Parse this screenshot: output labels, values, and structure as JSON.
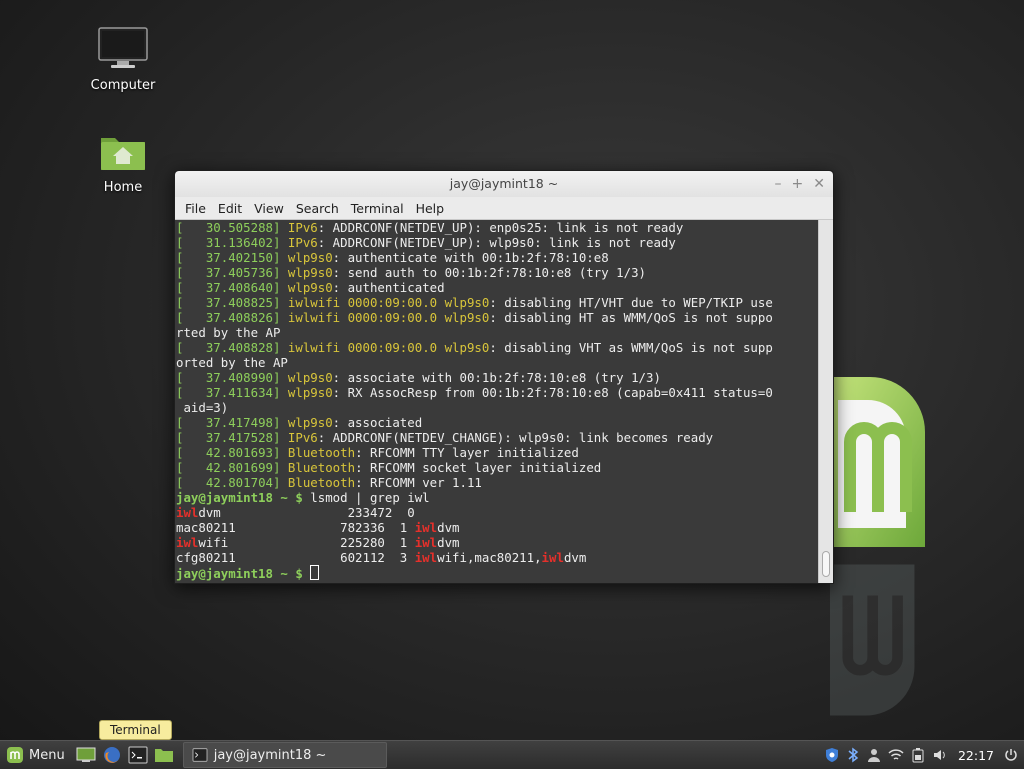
{
  "desktop": {
    "icons": [
      {
        "label": "Computer"
      },
      {
        "label": "Home"
      }
    ]
  },
  "window": {
    "title": "jay@jaymint18 ~",
    "menu": [
      "File",
      "Edit",
      "View",
      "Search",
      "Terminal",
      "Help"
    ]
  },
  "terminal": {
    "lines": [
      [
        {
          "t": "[",
          "c": "ts"
        },
        {
          "t": "   30.505288]",
          "c": "ts"
        },
        {
          "t": " IPv6",
          "c": "yel"
        },
        {
          "t": ": ADDRCONF(NETDEV_UP): enp0s25: link is not ready"
        }
      ],
      [
        {
          "t": "[",
          "c": "ts"
        },
        {
          "t": "   31.136402]",
          "c": "ts"
        },
        {
          "t": " IPv6",
          "c": "yel"
        },
        {
          "t": ": ADDRCONF(NETDEV_UP): wlp9s0: link is not ready"
        }
      ],
      [
        {
          "t": "[",
          "c": "ts"
        },
        {
          "t": "   37.402150]",
          "c": "ts"
        },
        {
          "t": " wlp9s0",
          "c": "yel"
        },
        {
          "t": ": authenticate with 00:1b:2f:78:10:e8"
        }
      ],
      [
        {
          "t": "[",
          "c": "ts"
        },
        {
          "t": "   37.405736]",
          "c": "ts"
        },
        {
          "t": " wlp9s0",
          "c": "yel"
        },
        {
          "t": ": send auth to 00:1b:2f:78:10:e8 (try 1/3)"
        }
      ],
      [
        {
          "t": "[",
          "c": "ts"
        },
        {
          "t": "   37.408640]",
          "c": "ts"
        },
        {
          "t": " wlp9s0",
          "c": "yel"
        },
        {
          "t": ": authenticated"
        }
      ],
      [
        {
          "t": "[",
          "c": "ts"
        },
        {
          "t": "   37.408825]",
          "c": "ts"
        },
        {
          "t": " iwlwifi 0000:09:00.0 wlp9s0",
          "c": "yel"
        },
        {
          "t": ": disabling HT/VHT due to WEP/TKIP use"
        }
      ],
      [
        {
          "t": "[",
          "c": "ts"
        },
        {
          "t": "   37.408826]",
          "c": "ts"
        },
        {
          "t": " iwlwifi 0000:09:00.0 wlp9s0",
          "c": "yel"
        },
        {
          "t": ": disabling HT as WMM/QoS is not suppo"
        }
      ],
      [
        {
          "t": "rted by the AP"
        }
      ],
      [
        {
          "t": "[",
          "c": "ts"
        },
        {
          "t": "   37.408828]",
          "c": "ts"
        },
        {
          "t": " iwlwifi 0000:09:00.0 wlp9s0",
          "c": "yel"
        },
        {
          "t": ": disabling VHT as WMM/QoS is not supp"
        }
      ],
      [
        {
          "t": "orted by the AP"
        }
      ],
      [
        {
          "t": "[",
          "c": "ts"
        },
        {
          "t": "   37.408990]",
          "c": "ts"
        },
        {
          "t": " wlp9s0",
          "c": "yel"
        },
        {
          "t": ": associate with 00:1b:2f:78:10:e8 (try 1/3)"
        }
      ],
      [
        {
          "t": "[",
          "c": "ts"
        },
        {
          "t": "   37.411634]",
          "c": "ts"
        },
        {
          "t": " wlp9s0",
          "c": "yel"
        },
        {
          "t": ": RX AssocResp from 00:1b:2f:78:10:e8 (capab=0x411 status=0"
        }
      ],
      [
        {
          "t": " aid=3)"
        }
      ],
      [
        {
          "t": "[",
          "c": "ts"
        },
        {
          "t": "   37.417498]",
          "c": "ts"
        },
        {
          "t": " wlp9s0",
          "c": "yel"
        },
        {
          "t": ": associated"
        }
      ],
      [
        {
          "t": "[",
          "c": "ts"
        },
        {
          "t": "   37.417528]",
          "c": "ts"
        },
        {
          "t": " IPv6",
          "c": "yel"
        },
        {
          "t": ": ADDRCONF(NETDEV_CHANGE): wlp9s0: link becomes ready"
        }
      ],
      [
        {
          "t": "[",
          "c": "ts"
        },
        {
          "t": "   42.801693]",
          "c": "ts"
        },
        {
          "t": " Bluetooth",
          "c": "yel"
        },
        {
          "t": ": RFCOMM TTY layer initialized"
        }
      ],
      [
        {
          "t": "[",
          "c": "ts"
        },
        {
          "t": "   42.801699]",
          "c": "ts"
        },
        {
          "t": " Bluetooth",
          "c": "yel"
        },
        {
          "t": ": RFCOMM socket layer initialized"
        }
      ],
      [
        {
          "t": "[",
          "c": "ts"
        },
        {
          "t": "   42.801704]",
          "c": "ts"
        },
        {
          "t": " Bluetooth",
          "c": "yel"
        },
        {
          "t": ": RFCOMM ver 1.11"
        }
      ],
      [
        {
          "t": "jay@jaymint18 ~ $",
          "c": "prompt"
        },
        {
          "t": " lsmod | grep iwl"
        }
      ],
      [
        {
          "t": "iwl",
          "c": "red"
        },
        {
          "t": "dvm                 233472  0"
        }
      ],
      [
        {
          "t": "mac80211              782336  1 "
        },
        {
          "t": "iwl",
          "c": "red"
        },
        {
          "t": "dvm"
        }
      ],
      [
        {
          "t": "iwl",
          "c": "red"
        },
        {
          "t": "wifi               225280  1 "
        },
        {
          "t": "iwl",
          "c": "red"
        },
        {
          "t": "dvm"
        }
      ],
      [
        {
          "t": "cfg80211              602112  3 "
        },
        {
          "t": "iwl",
          "c": "red"
        },
        {
          "t": "wifi,mac80211,"
        },
        {
          "t": "iwl",
          "c": "red"
        },
        {
          "t": "dvm"
        }
      ],
      [
        {
          "t": "jay@jaymint18 ~ $",
          "c": "prompt"
        },
        {
          "t": " "
        },
        {
          "t": "",
          "c": "cursor"
        }
      ]
    ]
  },
  "tooltip": "Terminal",
  "panel": {
    "menu_label": "Menu",
    "task_label": "jay@jaymint18 ~",
    "clock": "22:17"
  },
  "colors": {
    "mint_green": "#8ecf5b",
    "highlight_red": "#e5302b",
    "terminal_bg": "#3a3a3a"
  }
}
